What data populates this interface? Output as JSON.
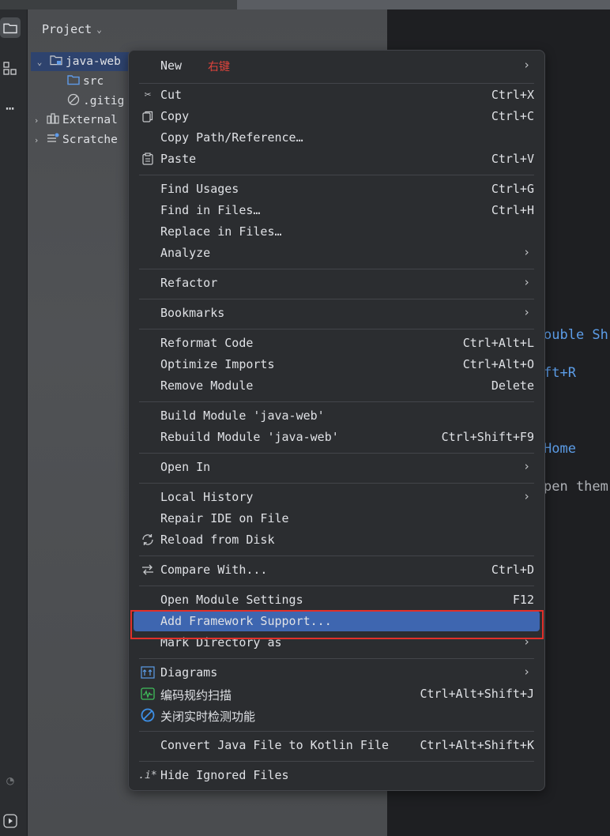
{
  "project_panel": {
    "title": "Project",
    "tree": [
      {
        "label": "java-web",
        "expanded": true,
        "selected": true,
        "icon": "module-folder-icon"
      },
      {
        "label": "src",
        "icon": "folder-icon"
      },
      {
        "label": ".gitig",
        "icon": "ignored-file-icon"
      },
      {
        "label": "External",
        "icon": "library-icon"
      },
      {
        "label": "Scratche",
        "icon": "scratches-icon"
      }
    ]
  },
  "editor_hints": {
    "line1": "ouble Sh",
    "line2": "ft+R",
    "line3": "Home",
    "line4": "pen them"
  },
  "context_menu": {
    "items": {
      "new": {
        "label": "New",
        "annotation": "右键"
      },
      "cut": {
        "label": "Cut",
        "shortcut": "Ctrl+X"
      },
      "copy": {
        "label": "Copy",
        "shortcut": "Ctrl+C"
      },
      "copy_path": {
        "label": "Copy Path/Reference…"
      },
      "paste": {
        "label": "Paste",
        "shortcut": "Ctrl+V"
      },
      "find_usages": {
        "label": "Find Usages",
        "shortcut": "Ctrl+G"
      },
      "find_in_files": {
        "label": "Find in Files…",
        "shortcut": "Ctrl+H"
      },
      "replace_in_files": {
        "label": "Replace in Files…"
      },
      "analyze": {
        "label": "Analyze"
      },
      "refactor": {
        "label": "Refactor"
      },
      "bookmarks": {
        "label": "Bookmarks"
      },
      "reformat_code": {
        "label": "Reformat Code",
        "shortcut": "Ctrl+Alt+L"
      },
      "optimize_imports": {
        "label": "Optimize Imports",
        "shortcut": "Ctrl+Alt+O"
      },
      "remove_module": {
        "label": "Remove Module",
        "shortcut": "Delete"
      },
      "build_module": {
        "label": "Build Module 'java-web'"
      },
      "rebuild_module": {
        "label": "Rebuild Module 'java-web'",
        "shortcut": "Ctrl+Shift+F9"
      },
      "open_in": {
        "label": "Open In"
      },
      "local_history": {
        "label": "Local History"
      },
      "repair_ide": {
        "label": "Repair IDE on File"
      },
      "reload_from_disk": {
        "label": "Reload from Disk"
      },
      "compare_with": {
        "label": "Compare With...",
        "shortcut": "Ctrl+D"
      },
      "open_module_settings": {
        "label": "Open Module Settings",
        "shortcut": "F12"
      },
      "add_framework_support": {
        "label": "Add Framework Support..."
      },
      "mark_directory_as": {
        "label": "Mark Directory as"
      },
      "diagrams": {
        "label": "Diagrams"
      },
      "code_scan": {
        "label": "编码规约扫描",
        "shortcut": "Ctrl+Alt+Shift+J"
      },
      "close_realtime_check": {
        "label": "关闭实时检测功能"
      },
      "convert_java_kotlin": {
        "label": "Convert Java File to Kotlin File",
        "shortcut": "Ctrl+Alt+Shift+K"
      },
      "hide_ignored_files": {
        "label": "Hide Ignored Files"
      }
    },
    "highlighted_item": "add_framework_support",
    "highlight_color": "#3e66b0",
    "annotation_color": "#e1302a"
  }
}
